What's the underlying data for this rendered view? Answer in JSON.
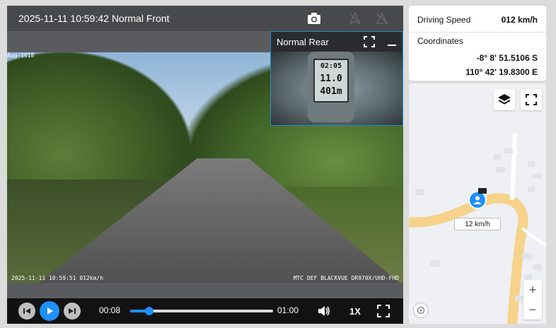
{
  "front": {
    "timestamp": "2025-11-11 10:59:42",
    "title": "Normal Front",
    "overlay_timestamp": "2025-11-11 10:59:51 012km/h",
    "overlay_model": "MTC DEF BLACKVUE DR970X/UHD-FHD",
    "overlay_corner": "Aug 1618"
  },
  "rear": {
    "title": "Normal Rear",
    "gps_lines": [
      "02:05",
      "11.0",
      "401m"
    ]
  },
  "controls": {
    "current_time": "00:08",
    "duration": "01:00",
    "progress": 0.133,
    "speed": "1X"
  },
  "info": {
    "driving_speed_label": "Driving Speed",
    "driving_speed_value": "012 km/h",
    "coordinates_label": "Coordinates",
    "lat": "-8° 8' 51.5106 S",
    "lon": "110° 42' 19.8300 E"
  },
  "map": {
    "speed_chip": "12 km/h",
    "zoom_in": "+",
    "zoom_out": "−"
  },
  "colors": {
    "accent": "#1e90ff",
    "road": "#f6d28a"
  },
  "icons": {
    "camera": "camera-icon",
    "layers": "layers-icon",
    "fullscreen": "fullscreen-icon",
    "play": "play-icon",
    "prev": "skip-back-icon",
    "next": "skip-forward-icon",
    "volume": "volume-icon"
  }
}
